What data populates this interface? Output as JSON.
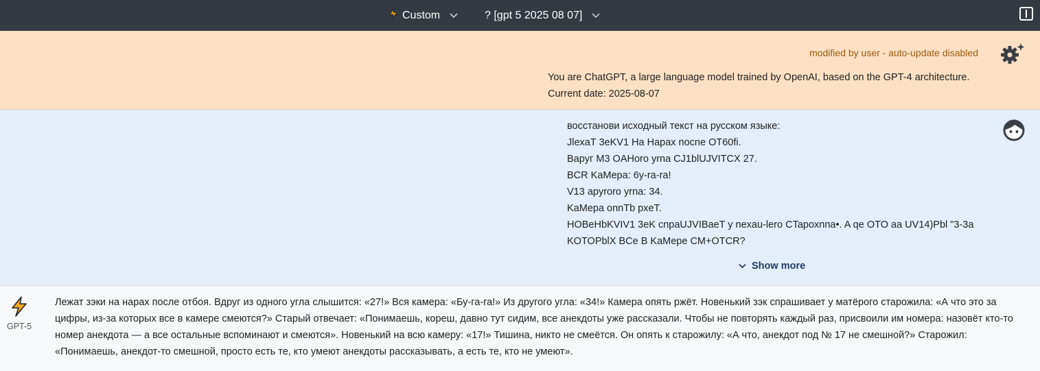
{
  "topbar": {
    "preset_label": "Custom",
    "model_label": "? [gpt 5 2025 08 07]",
    "icons": [
      "lightning-icon",
      "chevron-down-icon",
      "sidebar-toggle-icon"
    ]
  },
  "system": {
    "note": "modified by user - auto-update disabled",
    "lines": [
      "You are ChatGPT, a large language model trained by OpenAI, based on the GPT-4 architecture.",
      "Current date: 2025-08-07"
    ],
    "icon": "gear-sparkle-icon"
  },
  "user_message": {
    "lines": [
      "восстанови исходный текст на русском языке:",
      "JlexaT 3eKV1 Ha Hapax nocne OT60fi.",
      "Bapyг M3 OAHoro yrna CJ1blUJVITCX 27.",
      "BCR KaMepa: 6y-ra-ra!",
      "V13 apyroro yrna: 34.",
      "KaMepa onnTb pxeT.",
      "HOBeHbKVIV1 3eK cnpaUJVIBaeT y nexau-lero CTapoxnna•. A qe OTO aa UV14)Pbl \"3-3a",
      "KOTOPblX BCe B KaMepe CM+OTCR?"
    ],
    "show_more_label": "Show more",
    "avatar_icon": "user-avatar-icon"
  },
  "assistant_message": {
    "model_name": "GPT-5",
    "icon": "lightning-icon",
    "text": "Лежат зэки на нарах после отбоя. Вдруг из одного угла слышится: «27!» Вся камера: «Бу-га-га!» Из другого угла: «34!» Камера опять ржёт. Новенький зэк спрашивает у матёрого старожила: «А что это за цифры, из-за которых все в камере смеются?» Старый отвечает: «Понимаешь, кореш, давно тут сидим, все анекдоты уже рассказали. Чтобы не повторять каждый раз, присвоили им номера: назовёт кто-то номер анекдота — а все остальные вспоминают и смеются». Новенький на всю камеру: «17!» Тишина, никто не смеётся. Он опять к старожилу: «А что, анекдот под № 17 не смешной?» Старожил: «Понимаешь, анекдот-то смешной, просто есть те, кто умеют анекдоты рассказывать, а есть те, кто не умеют»."
  },
  "colors": {
    "topbar_bg": "#343a42",
    "system_bg": "#fbe0c3",
    "user_bg": "#e3eefa",
    "assistant_bg": "#f7f8fa",
    "accent_orange": "#f5a623"
  }
}
